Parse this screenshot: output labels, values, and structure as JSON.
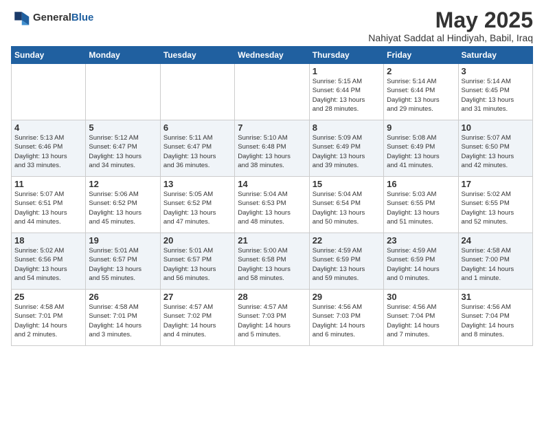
{
  "header": {
    "logo_general": "General",
    "logo_blue": "Blue",
    "month_year": "May 2025",
    "location": "Nahiyat Saddat al Hindiyah, Babil, Iraq"
  },
  "weekdays": [
    "Sunday",
    "Monday",
    "Tuesday",
    "Wednesday",
    "Thursday",
    "Friday",
    "Saturday"
  ],
  "weeks": [
    [
      {
        "day": "",
        "info": ""
      },
      {
        "day": "",
        "info": ""
      },
      {
        "day": "",
        "info": ""
      },
      {
        "day": "",
        "info": ""
      },
      {
        "day": "1",
        "info": "Sunrise: 5:15 AM\nSunset: 6:44 PM\nDaylight: 13 hours\nand 28 minutes."
      },
      {
        "day": "2",
        "info": "Sunrise: 5:14 AM\nSunset: 6:44 PM\nDaylight: 13 hours\nand 29 minutes."
      },
      {
        "day": "3",
        "info": "Sunrise: 5:14 AM\nSunset: 6:45 PM\nDaylight: 13 hours\nand 31 minutes."
      }
    ],
    [
      {
        "day": "4",
        "info": "Sunrise: 5:13 AM\nSunset: 6:46 PM\nDaylight: 13 hours\nand 33 minutes."
      },
      {
        "day": "5",
        "info": "Sunrise: 5:12 AM\nSunset: 6:47 PM\nDaylight: 13 hours\nand 34 minutes."
      },
      {
        "day": "6",
        "info": "Sunrise: 5:11 AM\nSunset: 6:47 PM\nDaylight: 13 hours\nand 36 minutes."
      },
      {
        "day": "7",
        "info": "Sunrise: 5:10 AM\nSunset: 6:48 PM\nDaylight: 13 hours\nand 38 minutes."
      },
      {
        "day": "8",
        "info": "Sunrise: 5:09 AM\nSunset: 6:49 PM\nDaylight: 13 hours\nand 39 minutes."
      },
      {
        "day": "9",
        "info": "Sunrise: 5:08 AM\nSunset: 6:49 PM\nDaylight: 13 hours\nand 41 minutes."
      },
      {
        "day": "10",
        "info": "Sunrise: 5:07 AM\nSunset: 6:50 PM\nDaylight: 13 hours\nand 42 minutes."
      }
    ],
    [
      {
        "day": "11",
        "info": "Sunrise: 5:07 AM\nSunset: 6:51 PM\nDaylight: 13 hours\nand 44 minutes."
      },
      {
        "day": "12",
        "info": "Sunrise: 5:06 AM\nSunset: 6:52 PM\nDaylight: 13 hours\nand 45 minutes."
      },
      {
        "day": "13",
        "info": "Sunrise: 5:05 AM\nSunset: 6:52 PM\nDaylight: 13 hours\nand 47 minutes."
      },
      {
        "day": "14",
        "info": "Sunrise: 5:04 AM\nSunset: 6:53 PM\nDaylight: 13 hours\nand 48 minutes."
      },
      {
        "day": "15",
        "info": "Sunrise: 5:04 AM\nSunset: 6:54 PM\nDaylight: 13 hours\nand 50 minutes."
      },
      {
        "day": "16",
        "info": "Sunrise: 5:03 AM\nSunset: 6:55 PM\nDaylight: 13 hours\nand 51 minutes."
      },
      {
        "day": "17",
        "info": "Sunrise: 5:02 AM\nSunset: 6:55 PM\nDaylight: 13 hours\nand 52 minutes."
      }
    ],
    [
      {
        "day": "18",
        "info": "Sunrise: 5:02 AM\nSunset: 6:56 PM\nDaylight: 13 hours\nand 54 minutes."
      },
      {
        "day": "19",
        "info": "Sunrise: 5:01 AM\nSunset: 6:57 PM\nDaylight: 13 hours\nand 55 minutes."
      },
      {
        "day": "20",
        "info": "Sunrise: 5:01 AM\nSunset: 6:57 PM\nDaylight: 13 hours\nand 56 minutes."
      },
      {
        "day": "21",
        "info": "Sunrise: 5:00 AM\nSunset: 6:58 PM\nDaylight: 13 hours\nand 58 minutes."
      },
      {
        "day": "22",
        "info": "Sunrise: 4:59 AM\nSunset: 6:59 PM\nDaylight: 13 hours\nand 59 minutes."
      },
      {
        "day": "23",
        "info": "Sunrise: 4:59 AM\nSunset: 6:59 PM\nDaylight: 14 hours\nand 0 minutes."
      },
      {
        "day": "24",
        "info": "Sunrise: 4:58 AM\nSunset: 7:00 PM\nDaylight: 14 hours\nand 1 minute."
      }
    ],
    [
      {
        "day": "25",
        "info": "Sunrise: 4:58 AM\nSunset: 7:01 PM\nDaylight: 14 hours\nand 2 minutes."
      },
      {
        "day": "26",
        "info": "Sunrise: 4:58 AM\nSunset: 7:01 PM\nDaylight: 14 hours\nand 3 minutes."
      },
      {
        "day": "27",
        "info": "Sunrise: 4:57 AM\nSunset: 7:02 PM\nDaylight: 14 hours\nand 4 minutes."
      },
      {
        "day": "28",
        "info": "Sunrise: 4:57 AM\nSunset: 7:03 PM\nDaylight: 14 hours\nand 5 minutes."
      },
      {
        "day": "29",
        "info": "Sunrise: 4:56 AM\nSunset: 7:03 PM\nDaylight: 14 hours\nand 6 minutes."
      },
      {
        "day": "30",
        "info": "Sunrise: 4:56 AM\nSunset: 7:04 PM\nDaylight: 14 hours\nand 7 minutes."
      },
      {
        "day": "31",
        "info": "Sunrise: 4:56 AM\nSunset: 7:04 PM\nDaylight: 14 hours\nand 8 minutes."
      }
    ]
  ]
}
